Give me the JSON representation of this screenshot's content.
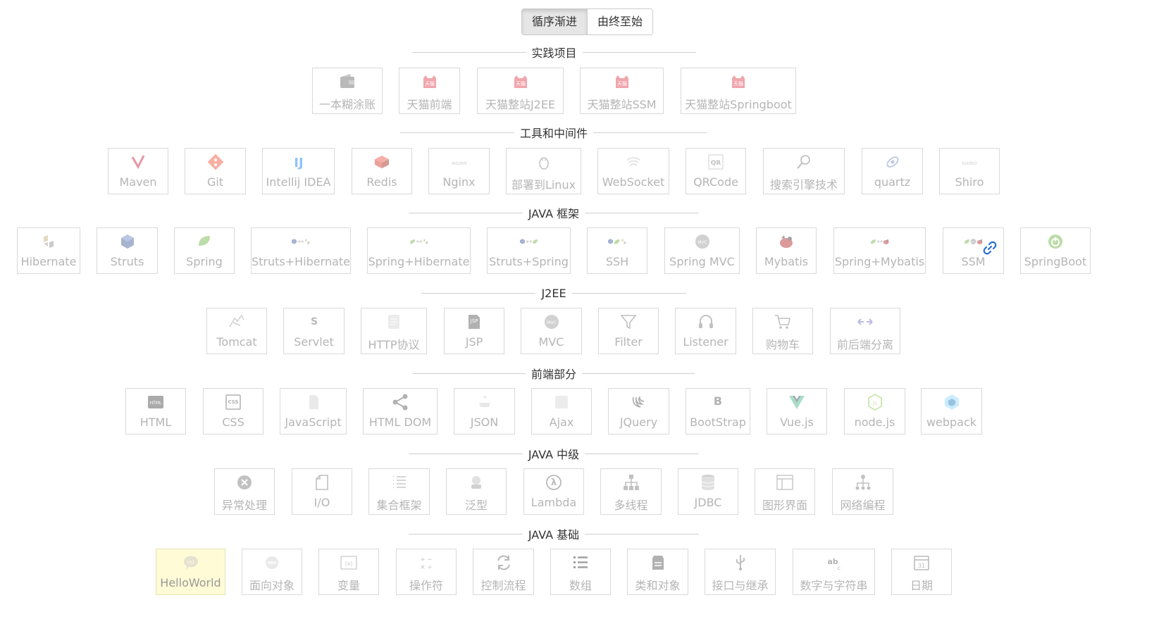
{
  "order_toggle": {
    "forward": "循序渐进",
    "reverse": "由终至始",
    "active": "forward"
  },
  "sections": [
    {
      "title": "实践项目",
      "items": [
        {
          "label": "一本糊涂账",
          "icon": "wallet-icon"
        },
        {
          "label": "天猫前端",
          "icon": "tmall-icon"
        },
        {
          "label": "天猫整站J2EE",
          "icon": "tmall-icon"
        },
        {
          "label": "天猫整站SSM",
          "icon": "tmall-icon"
        },
        {
          "label": "天猫整站Springboot",
          "icon": "tmall-icon"
        }
      ]
    },
    {
      "title": "工具和中间件",
      "items": [
        {
          "label": "Maven",
          "icon": "maven-icon"
        },
        {
          "label": "Git",
          "icon": "git-icon"
        },
        {
          "label": "Intellij IDEA",
          "icon": "intellij-icon"
        },
        {
          "label": "Redis",
          "icon": "redis-icon"
        },
        {
          "label": "Nginx",
          "icon": "nginx-icon"
        },
        {
          "label": "部署到Linux",
          "icon": "linux-icon"
        },
        {
          "label": "WebSocket",
          "icon": "websocket-icon"
        },
        {
          "label": "QRCode",
          "icon": "qrcode-icon"
        },
        {
          "label": "搜索引擎技术",
          "icon": "search-icon"
        },
        {
          "label": "quartz",
          "icon": "quartz-icon"
        },
        {
          "label": "Shiro",
          "icon": "shiro-icon"
        }
      ]
    },
    {
      "title": "JAVA 框架",
      "items": [
        {
          "label": "Hibernate",
          "icon": "hibernate-icon"
        },
        {
          "label": "Struts",
          "icon": "struts-icon"
        },
        {
          "label": "Spring",
          "icon": "spring-leaf-icon"
        },
        {
          "label": "Struts+Hibernate",
          "icon": "struts-hibernate-icon"
        },
        {
          "label": "Spring+Hibernate",
          "icon": "spring-hibernate-icon"
        },
        {
          "label": "Struts+Spring",
          "icon": "struts-spring-icon"
        },
        {
          "label": "SSH",
          "icon": "ssh-icon"
        },
        {
          "label": "Spring MVC",
          "icon": "spring-mvc-icon"
        },
        {
          "label": "Mybatis",
          "icon": "mybatis-icon"
        },
        {
          "label": "Spring+Mybatis",
          "icon": "spring-mybatis-icon"
        },
        {
          "label": "SSM",
          "icon": "ssm-icon"
        },
        {
          "label": "SpringBoot",
          "icon": "springboot-icon"
        }
      ]
    },
    {
      "title": "J2EE",
      "items": [
        {
          "label": "Tomcat",
          "icon": "tomcat-icon"
        },
        {
          "label": "Servlet",
          "icon": "servlet-icon"
        },
        {
          "label": "HTTP协议",
          "icon": "http-icon"
        },
        {
          "label": "JSP",
          "icon": "jsp-icon"
        },
        {
          "label": "MVC",
          "icon": "mvc-icon"
        },
        {
          "label": "Filter",
          "icon": "filter-icon"
        },
        {
          "label": "Listener",
          "icon": "headphones-icon"
        },
        {
          "label": "购物车",
          "icon": "cart-icon"
        },
        {
          "label": "前后端分离",
          "icon": "arrows-icon"
        }
      ]
    },
    {
      "title": "前端部分",
      "items": [
        {
          "label": "HTML",
          "icon": "html-icon"
        },
        {
          "label": "CSS",
          "icon": "css-icon"
        },
        {
          "label": "JavaScript",
          "icon": "javascript-icon"
        },
        {
          "label": "HTML DOM",
          "icon": "dom-tree-icon"
        },
        {
          "label": "JSON",
          "icon": "json-icon"
        },
        {
          "label": "Ajax",
          "icon": "ajax-icon"
        },
        {
          "label": "JQuery",
          "icon": "jquery-icon"
        },
        {
          "label": "BootStrap",
          "icon": "bootstrap-icon"
        },
        {
          "label": "Vue.js",
          "icon": "vue-icon"
        },
        {
          "label": "node.js",
          "icon": "nodejs-icon"
        },
        {
          "label": "webpack",
          "icon": "webpack-icon"
        }
      ]
    },
    {
      "title": "JAVA 中级",
      "items": [
        {
          "label": "异常处理",
          "icon": "exception-icon"
        },
        {
          "label": "I/O",
          "icon": "file-icon"
        },
        {
          "label": "集合框架",
          "icon": "list-icon"
        },
        {
          "label": "泛型",
          "icon": "generic-icon"
        },
        {
          "label": "Lambda",
          "icon": "lambda-icon"
        },
        {
          "label": "多线程",
          "icon": "hierarchy-icon"
        },
        {
          "label": "JDBC",
          "icon": "database-icon"
        },
        {
          "label": "图形界面",
          "icon": "gui-icon"
        },
        {
          "label": "网络编程",
          "icon": "network-icon"
        }
      ]
    },
    {
      "title": "JAVA 基础",
      "items": [
        {
          "label": "HelloWorld",
          "icon": "hello-bubble-icon",
          "active": true
        },
        {
          "label": "面向对象",
          "icon": "object-icon"
        },
        {
          "label": "变量",
          "icon": "variable-icon"
        },
        {
          "label": "操作符",
          "icon": "operator-icon"
        },
        {
          "label": "控制流程",
          "icon": "refresh-icon"
        },
        {
          "label": "数组",
          "icon": "array-list-icon"
        },
        {
          "label": "类和对象",
          "icon": "class-icon"
        },
        {
          "label": "接口与继承",
          "icon": "usb-icon"
        },
        {
          "label": "数字与字符串",
          "icon": "abc-icon"
        },
        {
          "label": "日期",
          "icon": "calendar-icon"
        }
      ]
    }
  ],
  "icon_glyphs": {
    "servlet-icon": "S",
    "bootstrap-icon": "B",
    "html-icon": "HTML",
    "css-icon": "CSS",
    "jsp-icon": "JSP",
    "mvc-icon": "MVC",
    "variable-icon": "(x)",
    "operator-icon": "+-×÷",
    "abc-icon": "ab",
    "calendar-icon": "31",
    "nginx-icon": "NGINX",
    "shiro-icon": "SHIRO",
    "qrcode-icon": "QR",
    "lambda-icon": "λ",
    "hello-bubble-icon": "Hi!",
    "object-icon": "OBJ"
  },
  "colors": {
    "active_bg": "#fffbd6",
    "spring_green": "#6db33f",
    "maven_red": "#c71a36",
    "git_orange": "#f05033",
    "intellij_blue": "#087cfa",
    "redis_red": "#d82c20",
    "vue_green": "#41b883",
    "mybatis_red": "#b22222",
    "struts_blue": "#3d5a98",
    "link_blue": "#2a6fd6"
  }
}
